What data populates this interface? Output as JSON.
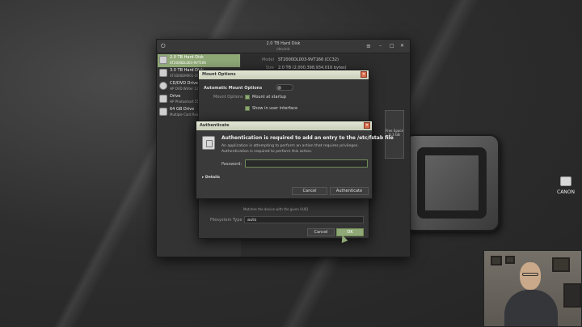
{
  "disks": {
    "title": "2.0 TB Hard Disk",
    "subtitle": "/dev/sdc",
    "sidebar": [
      {
        "name": "2.0 TB Hard Disk",
        "sub": "ST2000DL003-9VT166"
      },
      {
        "name": "3.0 TB Hard Disk",
        "sub": "ST3000DM001-1CH166"
      },
      {
        "name": "CD/DVD Drive",
        "sub": "HP DVD Writer 1260r"
      },
      {
        "name": "Drive",
        "sub": "HP Photosmart 55"
      },
      {
        "name": "64 GB Drive",
        "sub": "Multiple Card Rea..."
      }
    ],
    "model_label": "Model",
    "model_value": "ST2000DL003-9VT166 (CC32)",
    "size_label": "Size",
    "size_value": "2.0 TB (2,000,398,934,016 bytes)",
    "free_space": "Free Space",
    "free_space_size": "6.3 GB"
  },
  "mount_options": {
    "title": "Mount Options",
    "automatic_label": "Automatic Mount Options",
    "mount_options_label": "Mount Options",
    "mount_at_startup": "Mount at startup",
    "show_in_ui": "Show in user interface",
    "matches_text": "Matches the device with the given UUID",
    "filesystem_label": "Filesystem Type",
    "filesystem_value": "auto",
    "cancel_label": "Cancel",
    "ok_label": "OK"
  },
  "auth": {
    "title": "Authenticate",
    "heading": "Authentication is required to add an entry to the /etc/fstab file",
    "line1": "An application is attempting to perform an action that requires privileges.",
    "line2": "Authentication is required to perform this action.",
    "password_label": "Password:",
    "password_value": "",
    "details_label": "Details",
    "cancel_label": "Cancel",
    "authenticate_label": "Authenticate"
  },
  "desktop": {
    "canon_label": "CANON"
  },
  "colors": {
    "accent": "#8fa876",
    "titlebar": "#d6dbc8",
    "close": "#d66a4b"
  }
}
